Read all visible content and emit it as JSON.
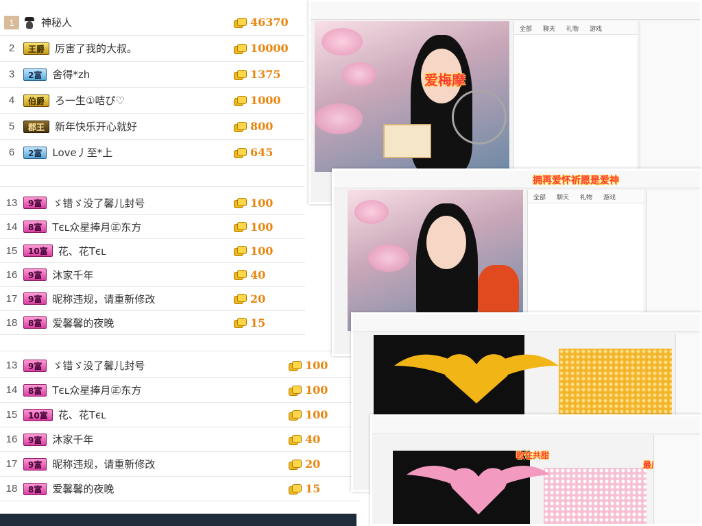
{
  "top_list": [
    {
      "rank": "1",
      "badge": "",
      "name": "神秘人",
      "amount": "46370"
    },
    {
      "rank": "2",
      "badge": "王爵",
      "name": "厉害了我的大叔。",
      "amount": "10000"
    },
    {
      "rank": "3",
      "badge": "2富",
      "name": "舍得*zh",
      "amount": "1375"
    },
    {
      "rank": "4",
      "badge": "伯爵",
      "name": "ろ一生①咭ぴ♡",
      "amount": "1000"
    },
    {
      "rank": "5",
      "badge": "郡王",
      "name": "新年快乐开心就好",
      "amount": "800"
    },
    {
      "rank": "6",
      "badge": "2富",
      "name": "Love丿至*上",
      "amount": "645"
    }
  ],
  "mid_list": [
    {
      "rank": "13",
      "badge": "9富",
      "name": "ゞ错ゞ没了馨儿封号",
      "amount": "100"
    },
    {
      "rank": "14",
      "badge": "8富",
      "name": "Tєʟ众星捧月㊣东方",
      "amount": "100"
    },
    {
      "rank": "15",
      "badge": "10富",
      "name": "花、花Tєʟ",
      "amount": "100"
    },
    {
      "rank": "16",
      "badge": "9富",
      "name": "沐家千年",
      "amount": "40"
    },
    {
      "rank": "17",
      "badge": "9富",
      "name": "昵称违规，请重新修改",
      "amount": "20"
    },
    {
      "rank": "18",
      "badge": "8富",
      "name": "爱馨馨的夜晚",
      "amount": "15"
    }
  ],
  "bottom_list": [
    {
      "rank": "13",
      "badge": "9富",
      "name": "ゞ错ゞ没了馨儿封号",
      "amount": "100"
    },
    {
      "rank": "14",
      "badge": "8富",
      "name": "Tєʟ众星捧月㊣东方",
      "amount": "100"
    },
    {
      "rank": "15",
      "badge": "10富",
      "name": "花、花Tєʟ",
      "amount": "100"
    },
    {
      "rank": "16",
      "badge": "9富",
      "name": "沐家千年",
      "amount": "40"
    },
    {
      "rank": "17",
      "badge": "9富",
      "name": "昵称违规，请重新修改",
      "amount": "20"
    },
    {
      "rank": "18",
      "badge": "8富",
      "name": "爱馨馨的夜晚",
      "amount": "15"
    }
  ],
  "badge_styles": {
    "王爵": "b-gold",
    "伯爵": "b-gold",
    "郡王": "b-dark",
    "2富": "b-blue",
    "8富": "b-pink",
    "9富": "b-pink",
    "10富": "b-pink"
  },
  "shots": {
    "shot1": {
      "overlay": "爱梅摩"
    },
    "shot2": {
      "overlay": "拥再爱怀祈愿是爱神"
    },
    "shot4": {
      "overlay_left": "欧在共甜",
      "overlay_right": "最后最后最后"
    }
  },
  "colors": {
    "coin_amount": "#e8850f",
    "heart_gold": "#f2b516",
    "heart_pink": "#f39ac0"
  }
}
